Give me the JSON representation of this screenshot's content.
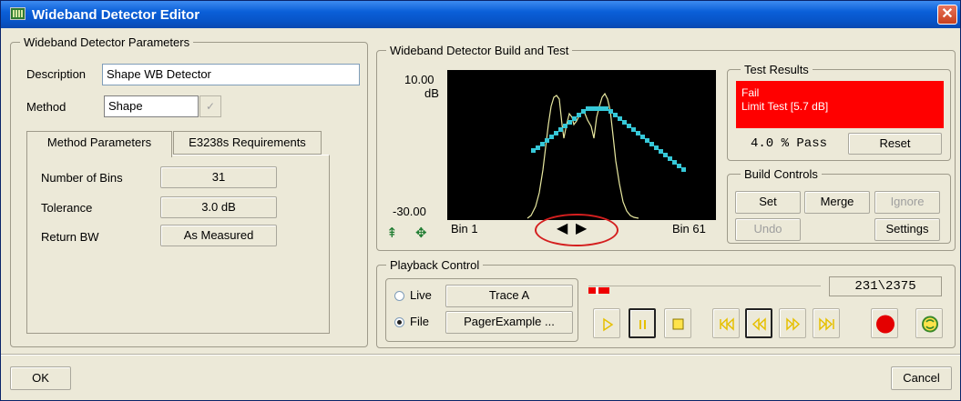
{
  "window": {
    "title": "Wideband Detector Editor"
  },
  "params": {
    "legend": "Wideband Detector Parameters",
    "description_label": "Description",
    "description_value": "Shape WB Detector",
    "method_label": "Method",
    "method_value": "Shape",
    "tabs": [
      "Method Parameters",
      "E3238s Requirements"
    ],
    "rows": [
      {
        "label": "Number of Bins",
        "value": "31"
      },
      {
        "label": "Tolerance",
        "value": "3.0 dB"
      },
      {
        "label": "Return BW",
        "value": "As Measured"
      }
    ]
  },
  "build": {
    "legend": "Wideband Detector Build and Test",
    "y_top": "10.00",
    "y_unit": "dB",
    "y_bottom": "-30.00",
    "x_left": "Bin 1",
    "x_right": "Bin 61",
    "trace_color": "#e8e8a0",
    "mask_color": "#36c8d8"
  },
  "results": {
    "legend": "Test Results",
    "status": "Fail",
    "detail": "Limit Test [5.7 dB]",
    "pass_text": "4.0 % Pass",
    "reset": "Reset"
  },
  "controls": {
    "legend": "Build Controls",
    "set": "Set",
    "merge": "Merge",
    "ignore": "Ignore",
    "undo": "Undo",
    "settings": "Settings"
  },
  "playback": {
    "legend": "Playback Control",
    "live_label": "Live",
    "live_value": "Trace A",
    "file_label": "File",
    "file_value": "PagerExample ...",
    "counter": "231\\2375",
    "progress": 0.09,
    "selected_source": "File"
  },
  "footer": {
    "ok": "OK",
    "cancel": "Cancel"
  }
}
